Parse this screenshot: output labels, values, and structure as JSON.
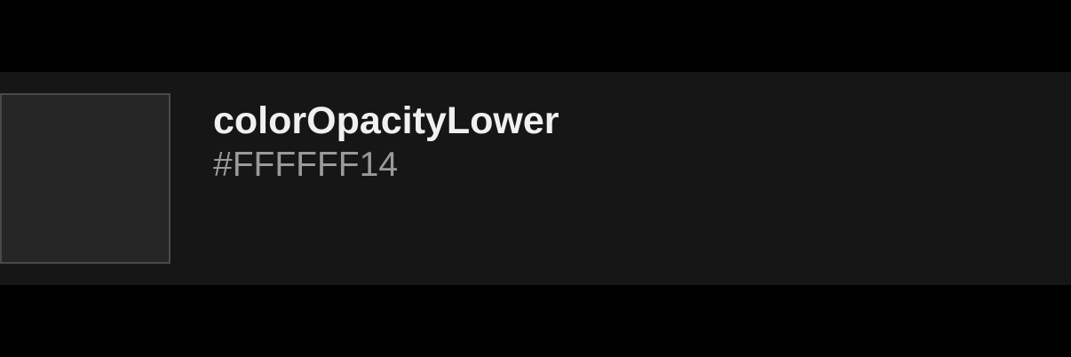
{
  "token": {
    "name": "colorOpacityLower",
    "value": "#FFFFFF14",
    "swatch_color": "#FFFFFF14"
  },
  "colors": {
    "background": "#000000",
    "row_background": "#161616",
    "swatch_border": "#4a4a4a",
    "name_text": "#f0f0f0",
    "value_text": "#9a9a9a"
  }
}
